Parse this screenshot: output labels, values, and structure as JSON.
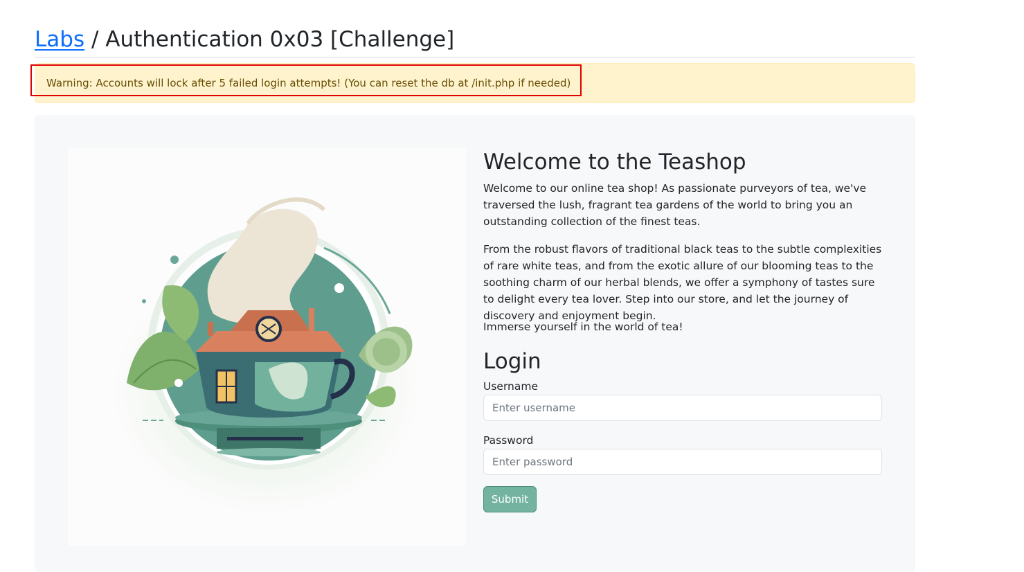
{
  "breadcrumb": {
    "link_label": "Labs",
    "separator": " / ",
    "title": "Authentication 0x03 [Challenge]"
  },
  "alert": {
    "text": "Warning: Accounts will lock after 5 failed login attempts! (You can reset the db at /init.php if needed)"
  },
  "hero_image": {
    "icon": "teacup-house-illustration"
  },
  "intro": {
    "title": "Welcome to the Teashop",
    "paragraph_1": "Welcome to our online tea shop! As passionate purveyors of tea, we've traversed the lush, fragrant tea gardens of the world to bring you an outstanding collection of the finest teas.",
    "paragraph_2": "From the robust flavors of traditional black teas to the subtle complexities of rare white teas, and from the exotic allure of our blooming teas to the soothing charm of our herbal blends, we offer a symphony of tastes sure to delight every tea lover. Step into our store, and let the journey of discovery and enjoyment begin.",
    "paragraph_3": "Immerse yourself in the world of tea!"
  },
  "login": {
    "title": "Login",
    "username_label": "Username",
    "username_placeholder": "Enter username",
    "username_value": "",
    "password_label": "Password",
    "password_placeholder": "Enter password",
    "password_value": "",
    "submit_label": "Submit"
  },
  "colors": {
    "link": "#0d6efd",
    "alert_bg": "#fff3cd",
    "alert_text": "#664d03",
    "highlight_border": "#e00000",
    "submit_bg": "#73b3a0",
    "teal": "#5f9e8f"
  }
}
